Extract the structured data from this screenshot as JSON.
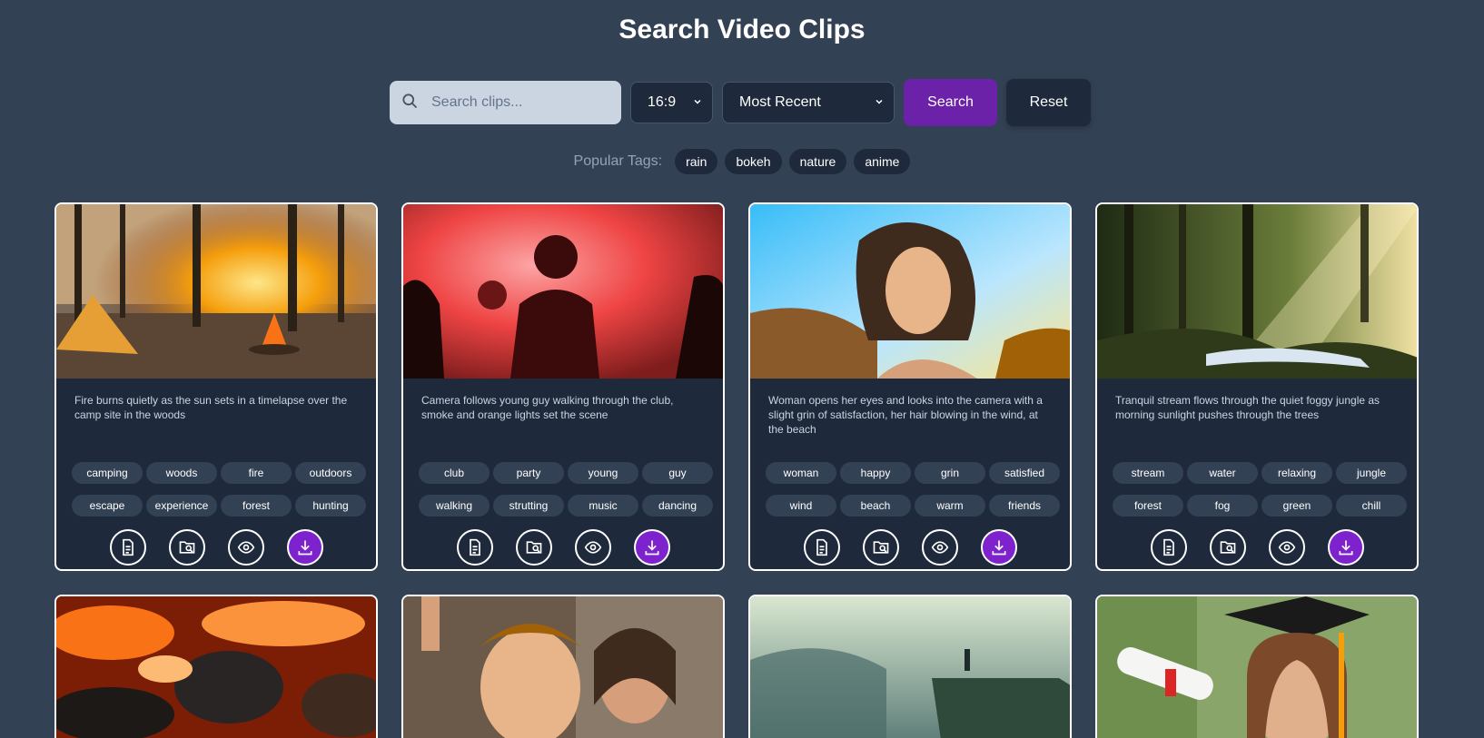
{
  "page": {
    "title": "Search Video Clips"
  },
  "search": {
    "placeholder": "Search clips...",
    "ratio": "16:9",
    "sort": "Most Recent",
    "search_label": "Search",
    "reset_label": "Reset"
  },
  "popular": {
    "label": "Popular Tags:",
    "tags": [
      "rain",
      "bokeh",
      "nature",
      "anime"
    ]
  },
  "cards": [
    {
      "description": "Fire burns quietly as the sun sets in a timelapse over the camp site in the woods",
      "tags": [
        "camping",
        "woods",
        "fire",
        "outdoors",
        "escape",
        "experience",
        "forest",
        "hunting"
      ]
    },
    {
      "description": "Camera follows young guy walking through the club, smoke and orange lights set the scene",
      "tags": [
        "club",
        "party",
        "young",
        "guy",
        "walking",
        "strutting",
        "music",
        "dancing"
      ]
    },
    {
      "description": "Woman opens her eyes and looks into the camera with a slight grin of satisfaction, her hair blowing in the wind, at the beach",
      "tags": [
        "woman",
        "happy",
        "grin",
        "satisfied",
        "wind",
        "beach",
        "warm",
        "friends"
      ]
    },
    {
      "description": "Tranquil stream flows through the quiet foggy jungle as morning sunlight pushes through the trees",
      "tags": [
        "stream",
        "water",
        "relaxing",
        "jungle",
        "forest",
        "fog",
        "green",
        "chill"
      ]
    }
  ],
  "icons": {
    "search": "search-icon",
    "details": "document-icon",
    "similar": "folder-search-icon",
    "preview": "eye-icon",
    "download": "download-icon"
  },
  "colors": {
    "background": "#334155",
    "card": "#1e293b",
    "accent": "#7e22ce"
  }
}
